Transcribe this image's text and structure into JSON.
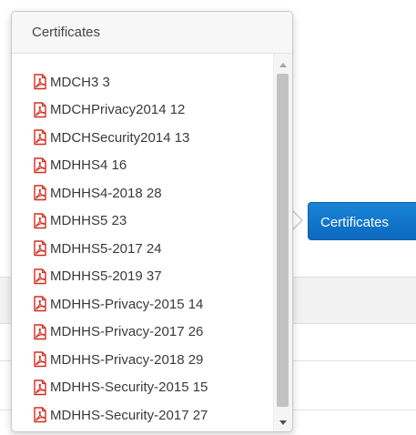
{
  "popover": {
    "title": "Certificates"
  },
  "certificates_button": {
    "label": "Certificates"
  },
  "certificates": [
    {
      "label": "MDCH3 3"
    },
    {
      "label": "MDCHPrivacy2014 12"
    },
    {
      "label": "MDCHSecurity2014 13"
    },
    {
      "label": "MDHHS4 16"
    },
    {
      "label": "MDHHS4-2018 28"
    },
    {
      "label": "MDHHS5 23"
    },
    {
      "label": "MDHHS5-2017 24"
    },
    {
      "label": "MDHHS5-2019 37"
    },
    {
      "label": "MDHHS-Privacy-2015 14"
    },
    {
      "label": "MDHHS-Privacy-2017 26"
    },
    {
      "label": "MDHHS-Privacy-2018 29"
    },
    {
      "label": "MDHHS-Security-2015 15"
    },
    {
      "label": "MDHHS-Security-2017 27"
    }
  ],
  "icons": {
    "file": "pdf-icon",
    "scroll_up": "chevron-up-icon",
    "scroll_down": "chevron-down-icon"
  },
  "colors": {
    "button_blue": "#0b6fc6",
    "pdf_red": "#d62b1f",
    "scroll_thumb": "#c2c2c2"
  }
}
